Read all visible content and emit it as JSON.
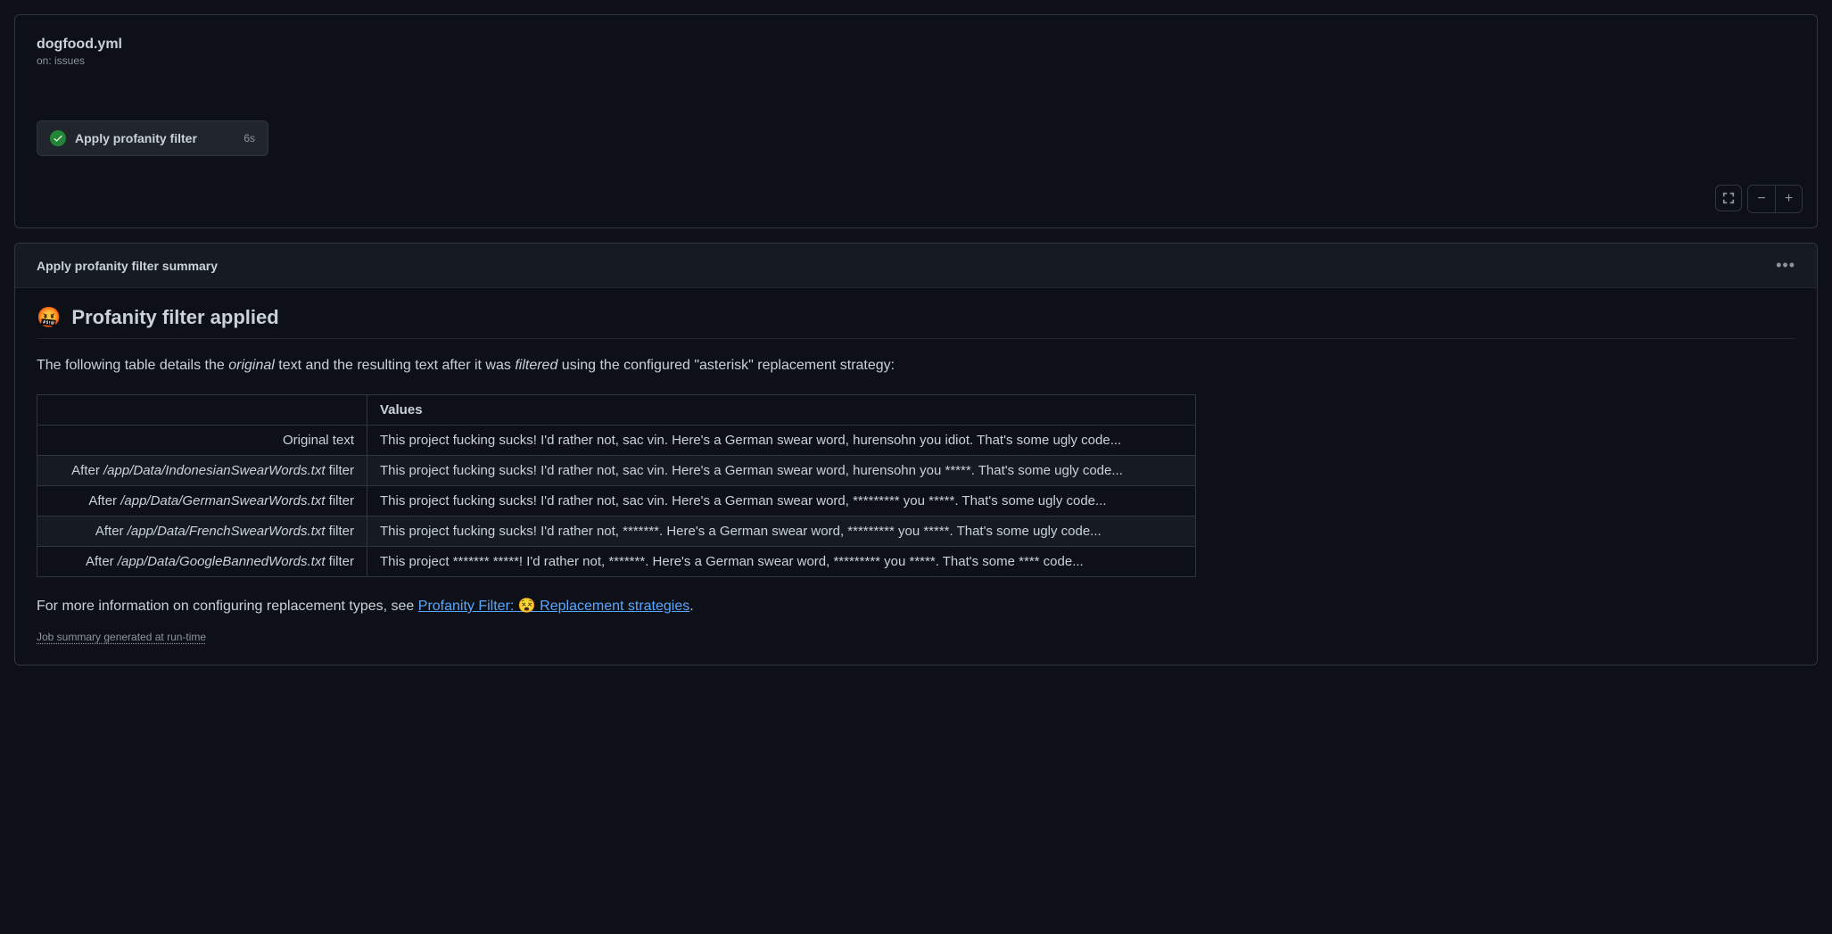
{
  "workflow": {
    "title": "dogfood.yml",
    "trigger": "on: issues",
    "job_name": "Apply profanity filter",
    "job_duration": "6s"
  },
  "summary": {
    "header_title": "Apply profanity filter summary",
    "heading_emoji": "🤬",
    "heading_text": "Profanity filter applied",
    "desc_pre": "The following table details the ",
    "desc_em1": "original",
    "desc_mid": " text and the resulting text after it was ",
    "desc_em2": "filtered",
    "desc_post": " using the configured \"asterisk\" replacement strategy:",
    "table": {
      "col_header_blank": "",
      "col_header_values": "Values",
      "rows": [
        {
          "label_prefix": "",
          "label_path": "",
          "label_suffix": "Original text",
          "value": "This project fucking sucks! I'd rather not, sac vin. Here's a German swear word, hurensohn you idiot. That's some ugly code..."
        },
        {
          "label_prefix": "After ",
          "label_path": "/app/Data/IndonesianSwearWords.txt",
          "label_suffix": " filter",
          "value": "This project fucking sucks! I'd rather not, sac vin. Here's a German swear word, hurensohn you *****. That's some ugly code..."
        },
        {
          "label_prefix": "After ",
          "label_path": "/app/Data/GermanSwearWords.txt",
          "label_suffix": " filter",
          "value": "This project fucking sucks! I'd rather not, sac vin. Here's a German swear word, ********* you *****. That's some ugly code..."
        },
        {
          "label_prefix": "After ",
          "label_path": "/app/Data/FrenchSwearWords.txt",
          "label_suffix": " filter",
          "value": "This project fucking sucks! I'd rather not, *******. Here's a German swear word, ********* you *****. That's some ugly code..."
        },
        {
          "label_prefix": "After ",
          "label_path": "/app/Data/GoogleBannedWords.txt",
          "label_suffix": " filter",
          "value": "This project ******* *****! I'd rather not, *******. Here's a German swear word, ********* you *****. That's some **** code..."
        }
      ]
    },
    "more_info_pre": "For more information on configuring replacement types, see ",
    "more_info_link": "Profanity Filter: 😵 Replacement strategies",
    "more_info_post": ".",
    "footer": "Job summary generated at run-time"
  }
}
